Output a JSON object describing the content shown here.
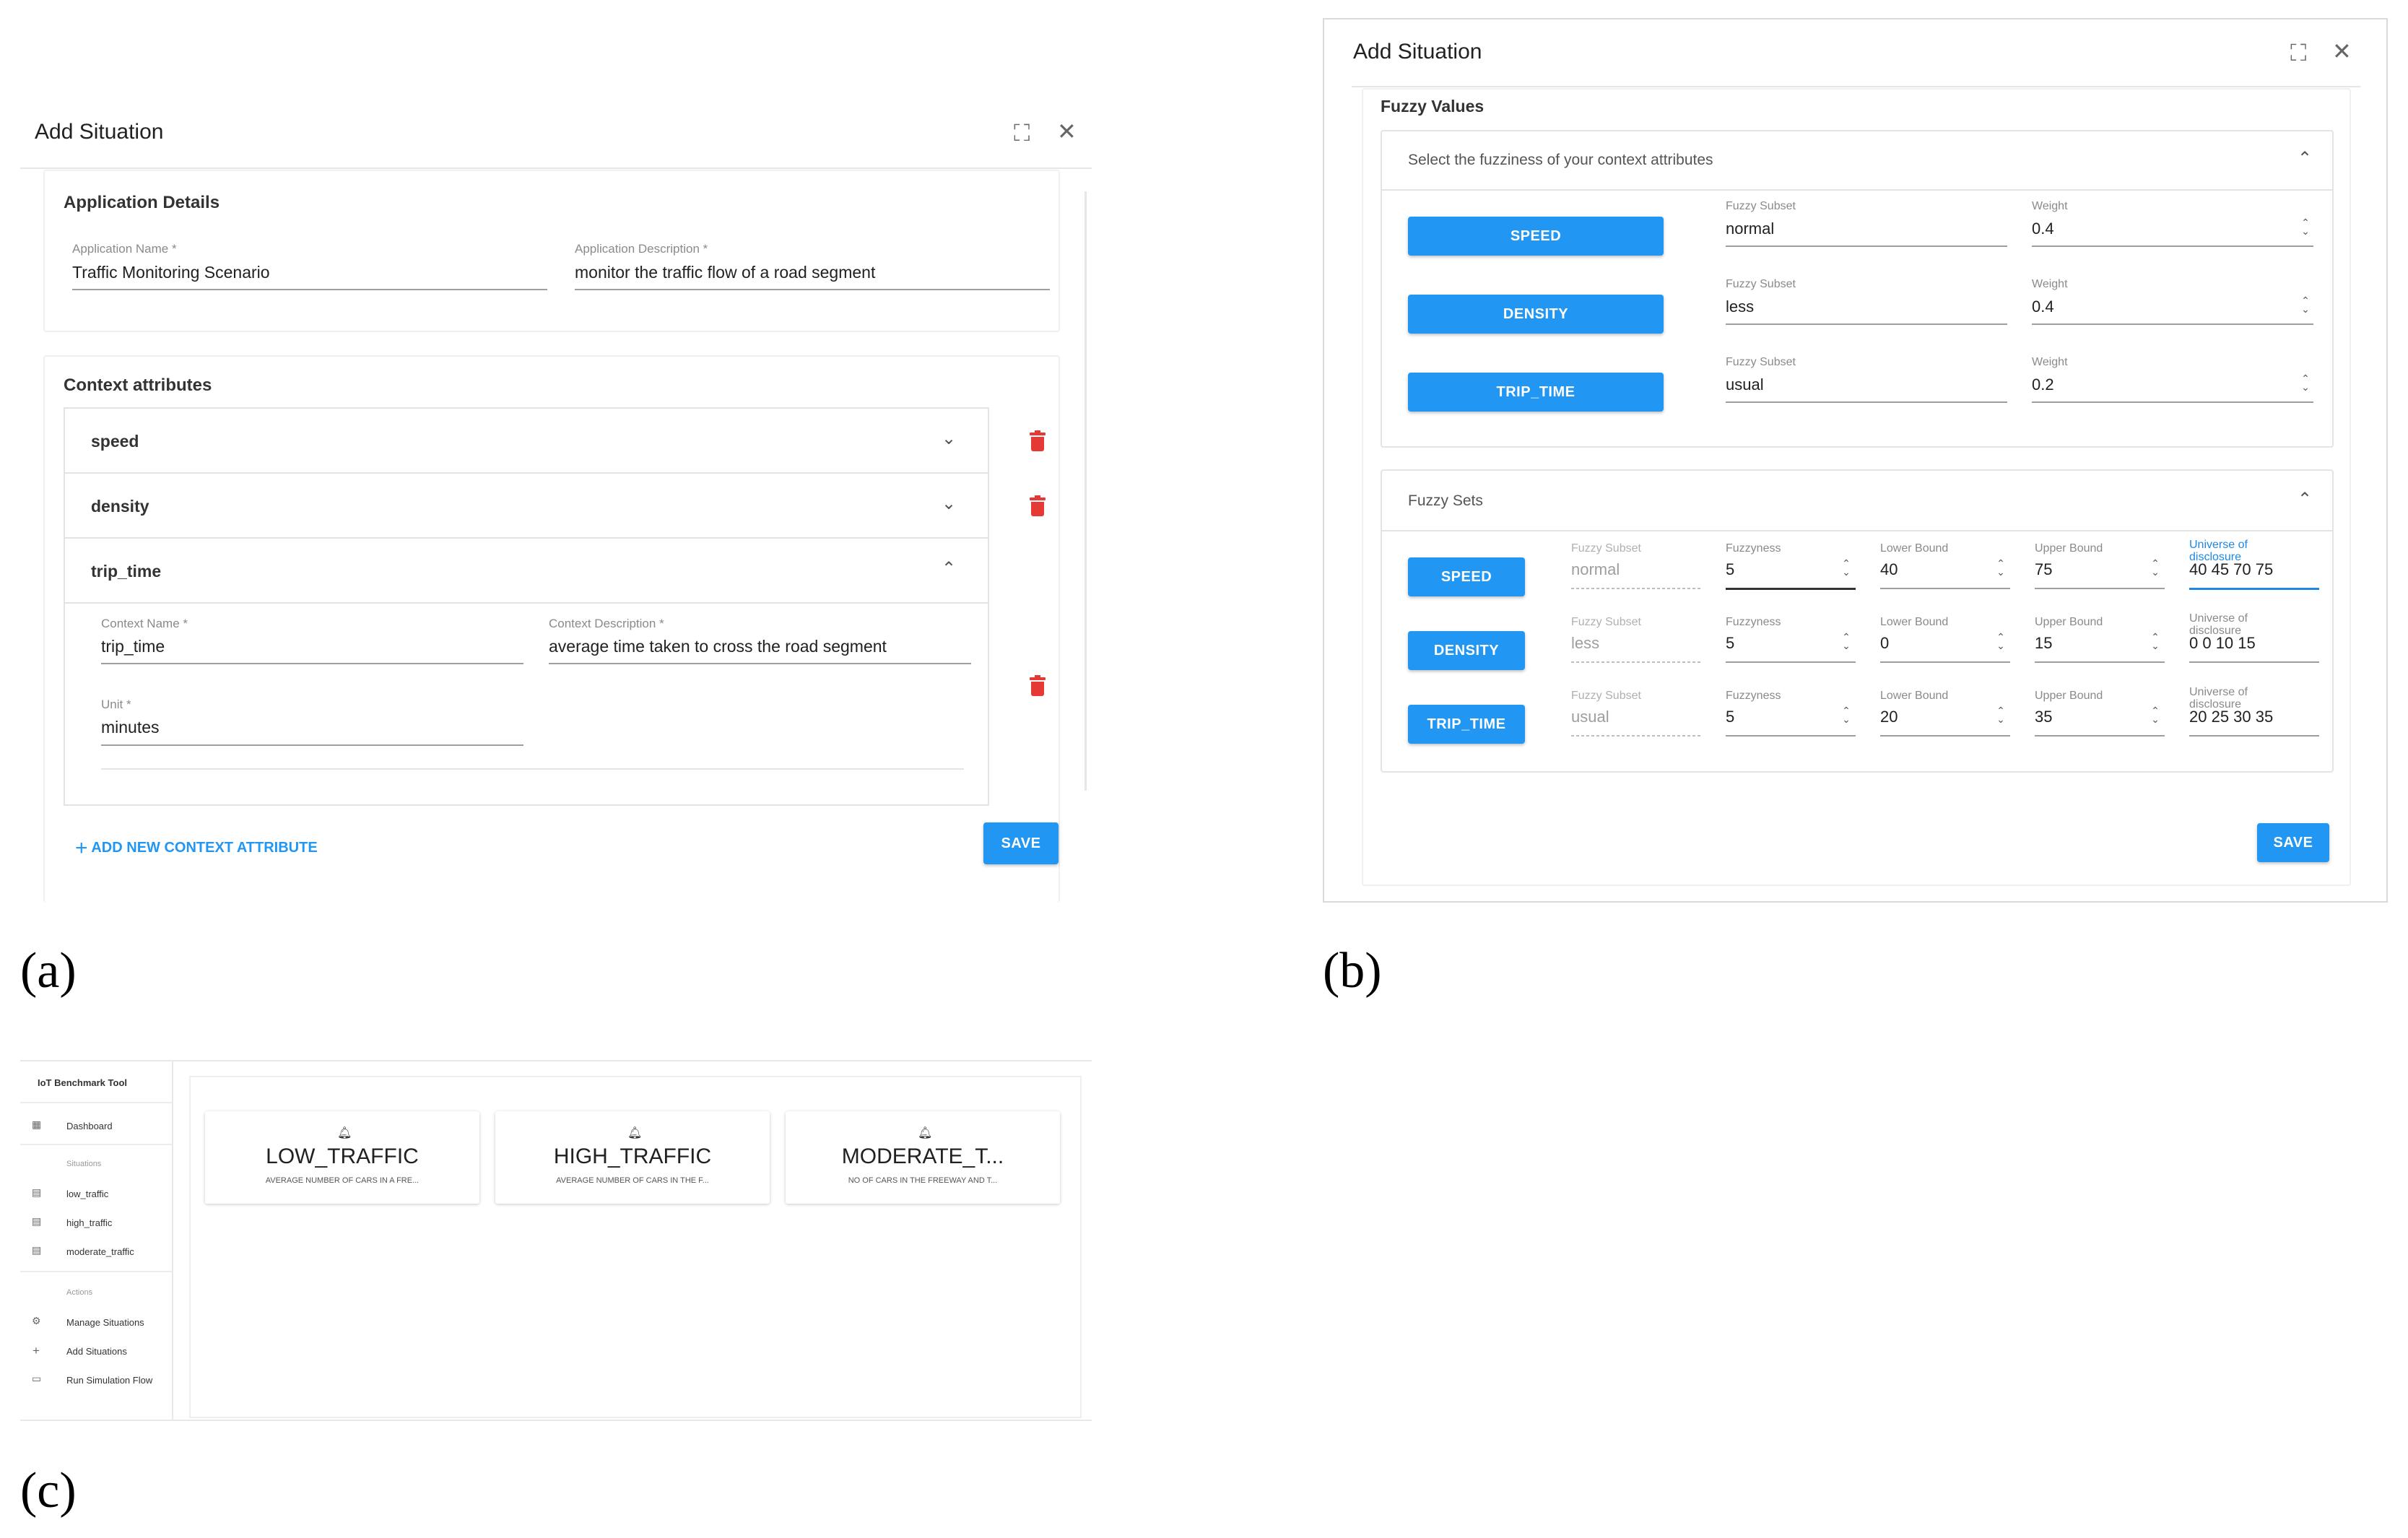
{
  "labels": {
    "a": "(a)",
    "b": "(b)",
    "c": "(c)"
  },
  "panel_a": {
    "title": "Add Situation",
    "application_details": {
      "section_title": "Application Details",
      "name_label": "Application Name *",
      "name_value": "Traffic Monitoring Scenario",
      "desc_label": "Application Description *",
      "desc_value": "monitor the traffic flow of a road segment"
    },
    "context": {
      "section_title": "Context attributes",
      "items": [
        "speed",
        "density",
        "trip_time"
      ],
      "expanded": {
        "name_label": "Context Name *",
        "name_value": "trip_time",
        "desc_label": "Context Description *",
        "desc_value": "average time taken to cross the road segment",
        "unit_label": "Unit *",
        "unit_value": "minutes"
      },
      "add_label": "ADD NEW CONTEXT ATTRIBUTE",
      "save_label": "SAVE"
    },
    "colors": {
      "accent": "#2196f3",
      "danger": "#e53935"
    }
  },
  "panel_b": {
    "title": "Add Situation",
    "section_title": "Fuzzy Values",
    "values_panel": {
      "header": "Select the fuzziness of your context attributes",
      "subset_label": "Fuzzy Subset",
      "weight_label": "Weight",
      "rows": [
        {
          "attr": "SPEED",
          "subset": "normal",
          "weight": "0.4"
        },
        {
          "attr": "DENSITY",
          "subset": "less",
          "weight": "0.4"
        },
        {
          "attr": "TRIP_TIME",
          "subset": "usual",
          "weight": "0.2"
        }
      ]
    },
    "sets_panel": {
      "header": "Fuzzy Sets",
      "col_subset": "Fuzzy Subset",
      "col_fuzzyness": "Fuzzyness",
      "col_lower": "Lower Bound",
      "col_upper": "Upper Bound",
      "col_universe": "Universe of disclosure",
      "rows": [
        {
          "attr": "SPEED",
          "subset": "normal",
          "fuzzyness": "5",
          "lower": "40",
          "upper": "75",
          "universe": "40 45 70 75"
        },
        {
          "attr": "DENSITY",
          "subset": "less",
          "fuzzyness": "5",
          "lower": "0",
          "upper": "15",
          "universe": "0 0 10 15"
        },
        {
          "attr": "TRIP_TIME",
          "subset": "usual",
          "fuzzyness": "5",
          "lower": "20",
          "upper": "35",
          "universe": "20 25 30 35"
        }
      ]
    },
    "save_label": "SAVE"
  },
  "panel_c": {
    "app_title": "IoT Benchmark Tool",
    "nav": {
      "dashboard": "Dashboard",
      "situations_header": "Situations",
      "situations": [
        "low_traffic",
        "high_traffic",
        "moderate_traffic"
      ],
      "actions_header": "Actions",
      "actions": [
        "Manage Situations",
        "Add Situations",
        "Run Simulation Flow"
      ]
    },
    "cards": [
      {
        "title": "LOW_TRAFFIC",
        "desc": "AVERAGE NUMBER OF CARS IN A FRE..."
      },
      {
        "title": "HIGH_TRAFFIC",
        "desc": "AVERAGE NUMBER OF CARS IN THE F..."
      },
      {
        "title": "MODERATE_T...",
        "desc": "NO OF CARS IN THE FREEWAY AND T..."
      }
    ]
  }
}
